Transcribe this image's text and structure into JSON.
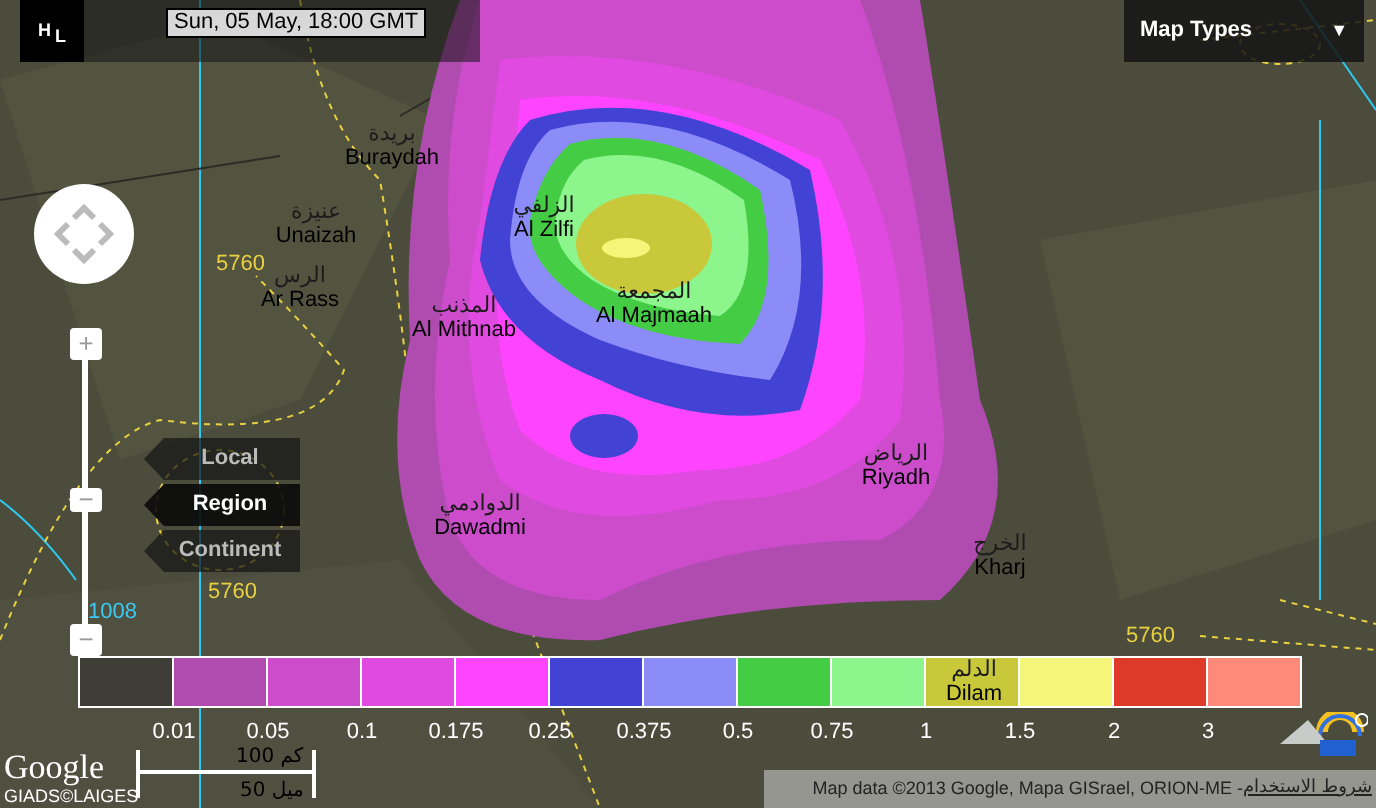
{
  "logo": {
    "letters": [
      "H",
      "L"
    ]
  },
  "timestamp": "Sun, 05 May, 18:00 GMT",
  "map_types": {
    "label": "Map Types",
    "arrow": "▼"
  },
  "zoom": {
    "plus": "+",
    "minus": "−",
    "thumb": "−",
    "level": 0.47
  },
  "scale_buttons": [
    {
      "label": "Local",
      "selected": false
    },
    {
      "label": "Region",
      "selected": true
    },
    {
      "label": "Continent",
      "selected": false
    }
  ],
  "places": [
    {
      "arabic": "بريدة",
      "name": "Buraydah"
    },
    {
      "arabic": "الزلفي",
      "name": "Al Zilfi"
    },
    {
      "arabic": "عنيزة",
      "name": "Unaizah"
    },
    {
      "arabic": "الرس",
      "name": "Ar Rass"
    },
    {
      "arabic": "المذنب",
      "name": "Al Mithnab"
    },
    {
      "arabic": "المجمعة",
      "name": "Al Majmaah"
    },
    {
      "arabic": "الرياض",
      "name": "Riyadh"
    },
    {
      "arabic": "الدوادمي",
      "name": "Dawadmi"
    },
    {
      "arabic": "الخرج",
      "name": "Kharj"
    },
    {
      "arabic": "الدلم",
      "name": "Dilam"
    }
  ],
  "contour_labels": [
    {
      "text": "5760",
      "kind": "height"
    },
    {
      "text": "5760",
      "kind": "height"
    },
    {
      "text": "1008",
      "kind": "pressure"
    },
    {
      "text": "5760",
      "kind": "height"
    }
  ],
  "legend": {
    "cells": [
      {
        "color": "#3e3e36"
      },
      {
        "color": "#b04cb0"
      },
      {
        "color": "#cc4ccc"
      },
      {
        "color": "#e04ae0"
      },
      {
        "color": "#ff44ff"
      },
      {
        "color": "#4242d4"
      },
      {
        "color": "#8c8cf8"
      },
      {
        "color": "#44cc44"
      },
      {
        "color": "#8cf58c"
      },
      {
        "color": "#c8c83a"
      },
      {
        "color": "#f5f57a"
      },
      {
        "color": "#dd3a2a"
      },
      {
        "color": "#ff8a7a"
      }
    ],
    "values": [
      "0.01",
      "0.05",
      "0.1",
      "0.175",
      "0.25",
      "0.375",
      "0.5",
      "0.75",
      "1",
      "1.5",
      "2",
      "3"
    ]
  },
  "scale_bar": {
    "metric": "100 كم",
    "imperial": "50 ميل"
  },
  "google_logo": "Google",
  "imagery_credit": "GIADS©LAIGES",
  "attribution": "Map data ©2013 Google, Mapa GISrael, ORION-ME - ",
  "terms_link": "شروط الاستخدام"
}
